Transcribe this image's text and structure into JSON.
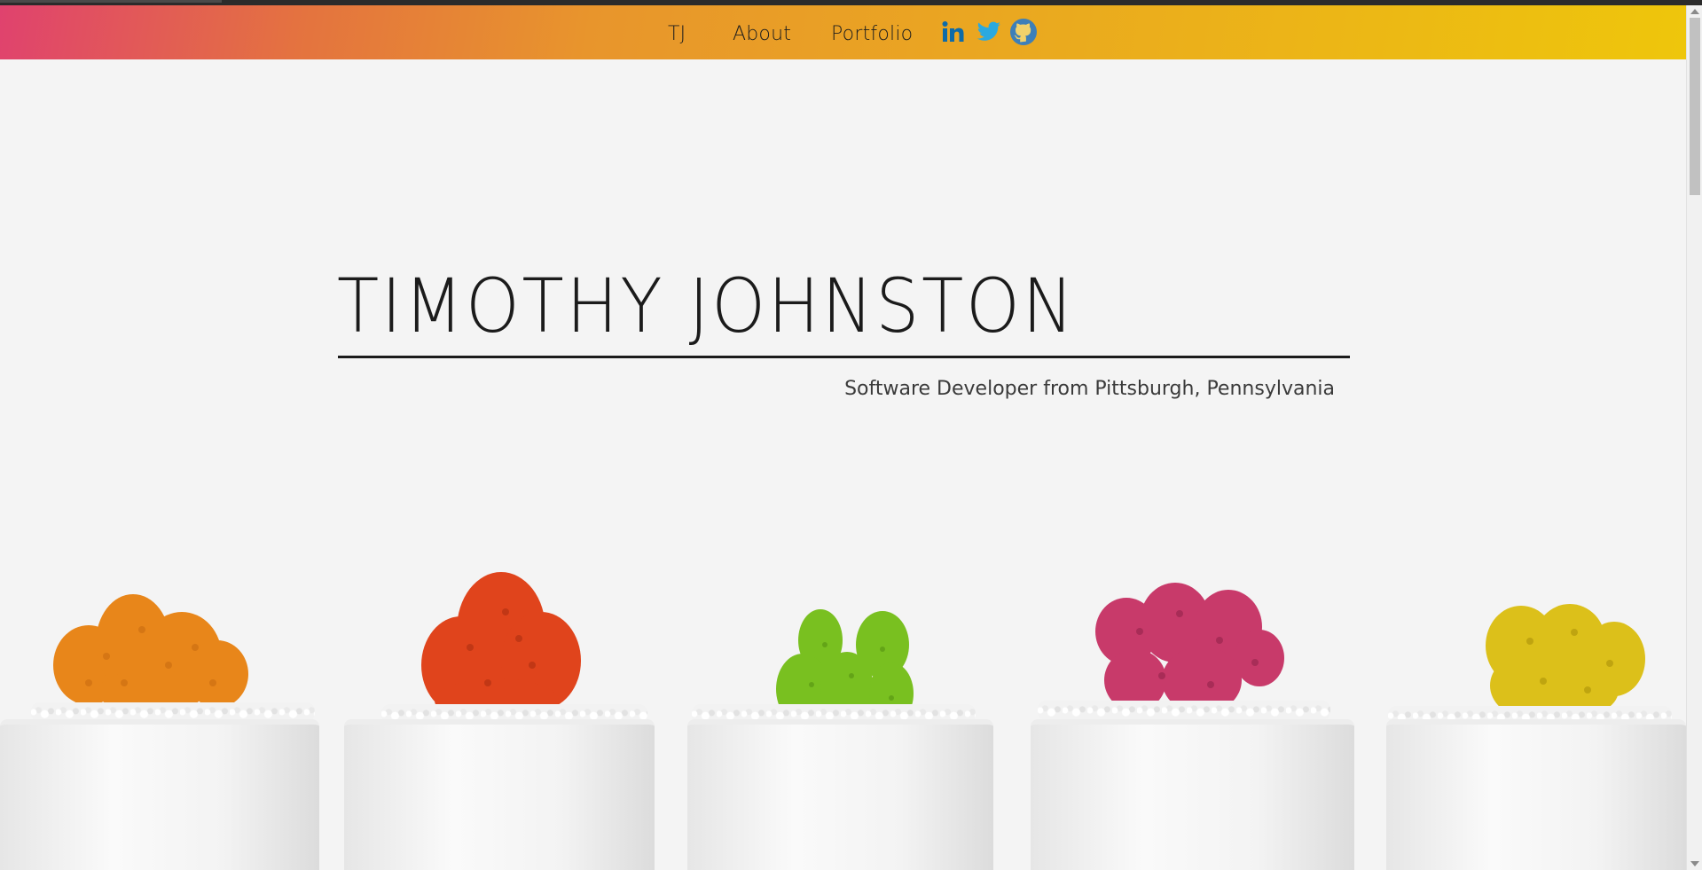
{
  "nav": {
    "brand": "TJ",
    "about": "About",
    "portfolio": "Portfolio"
  },
  "social": [
    {
      "name": "linkedin-icon",
      "color": "#0e6ba8"
    },
    {
      "name": "twitter-icon",
      "color": "#2aa9e0"
    },
    {
      "name": "github-icon",
      "color": "#3d7fb8"
    }
  ],
  "hero": {
    "title": "TIMOTHY JOHNSTON",
    "subtitle": "Software Developer from Pittsburgh, Pennsylvania"
  },
  "colors": {
    "gradient_start": "#e0426e",
    "gradient_end": "#eec60b",
    "text": "#1b1b1b",
    "background": "#f4f4f4"
  },
  "plants": [
    {
      "color": "orange",
      "hex": "#e8861a"
    },
    {
      "color": "red",
      "hex": "#e0441c"
    },
    {
      "color": "green",
      "hex": "#79c020"
    },
    {
      "color": "pink",
      "hex": "#c83a6a"
    },
    {
      "color": "yellow",
      "hex": "#dcc01a"
    }
  ]
}
